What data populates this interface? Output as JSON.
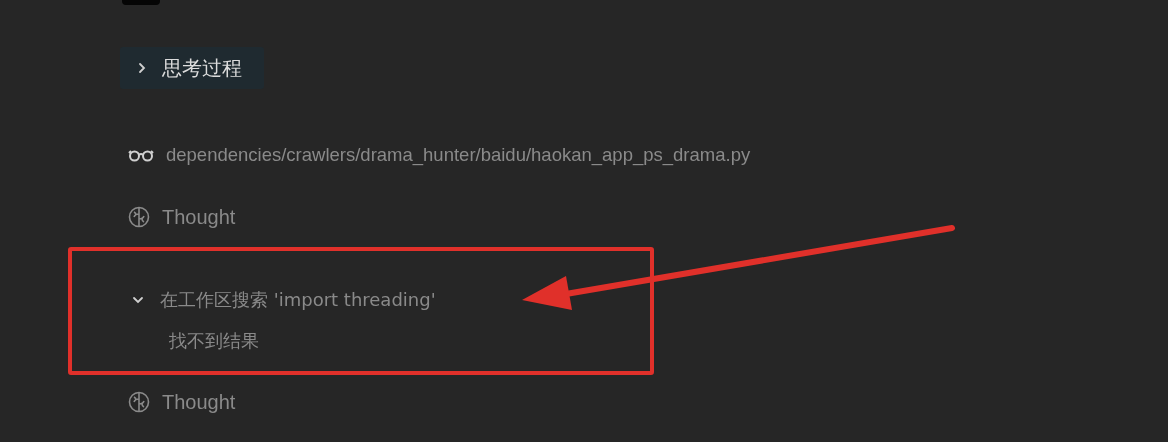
{
  "thinking_toggle": {
    "label": "思考过程",
    "expanded": false
  },
  "steps": [
    {
      "kind": "file",
      "text": "dependencies/crawlers/drama_hunter/baidu/haokan_app_ps_drama.py",
      "highlighted": false
    },
    {
      "kind": "thought",
      "text": "Thought",
      "highlighted": false
    },
    {
      "kind": "search",
      "text": "在工作区搜索 'import threading'",
      "expanded": true,
      "result": "找不到结果",
      "highlighted": true
    },
    {
      "kind": "thought",
      "text": "Thought",
      "highlighted": false
    }
  ]
}
